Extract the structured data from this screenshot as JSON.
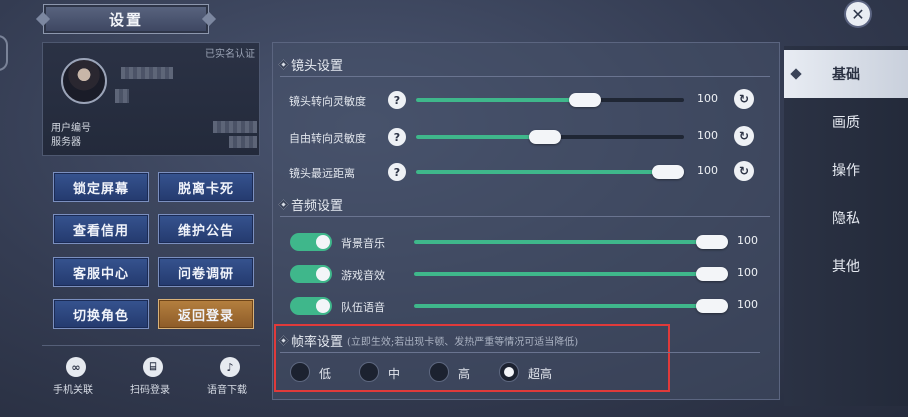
{
  "header": {
    "title": "设置",
    "close_icon": "close-icon"
  },
  "profile": {
    "verified_label": "已实名认证",
    "user_id_label": "用户编号",
    "server_label": "服务器"
  },
  "actions": [
    {
      "label": "锁定屏幕"
    },
    {
      "label": "脱离卡死"
    },
    {
      "label": "查看信用"
    },
    {
      "label": "维护公告"
    },
    {
      "label": "客服中心"
    },
    {
      "label": "问卷调研"
    },
    {
      "label": "切换角色"
    },
    {
      "label": "返回登录",
      "accent": "#a46d34"
    }
  ],
  "bottom_links": [
    {
      "label": "手机关联",
      "icon": "link-icon"
    },
    {
      "label": "扫码登录",
      "icon": "scan-icon"
    },
    {
      "label": "语音下载",
      "icon": "music-note-icon"
    }
  ],
  "camera": {
    "title": "镜头设置",
    "rows": [
      {
        "label": "镜头转向灵敏度",
        "value": "100",
        "level": 0.63
      },
      {
        "label": "自由转向灵敏度",
        "value": "100",
        "level": 0.48
      },
      {
        "label": "镜头最远距离",
        "value": "100",
        "level": 1.0
      }
    ]
  },
  "audio": {
    "title": "音频设置",
    "rows": [
      {
        "label": "背景音乐",
        "value": "100",
        "enabled": true,
        "level": 1.0
      },
      {
        "label": "游戏音效",
        "value": "100",
        "enabled": true,
        "level": 1.0
      },
      {
        "label": "队伍语音",
        "value": "100",
        "enabled": true,
        "level": 1.0
      }
    ]
  },
  "framerate": {
    "title": "帧率设置",
    "note": "(立即生效;若出现卡顿、发热严重等情况可适当降低)",
    "options": [
      "低",
      "中",
      "高",
      "超高"
    ],
    "selected": "超高"
  },
  "tabs": [
    {
      "label": "基础",
      "active": true
    },
    {
      "label": "画质"
    },
    {
      "label": "操作"
    },
    {
      "label": "隐私"
    },
    {
      "label": "其他"
    }
  ],
  "colors": {
    "accent_green": "#3fb78b",
    "highlight_red": "#e03a3a",
    "button_blue": "#2d4680",
    "button_orange": "#a46d34"
  }
}
